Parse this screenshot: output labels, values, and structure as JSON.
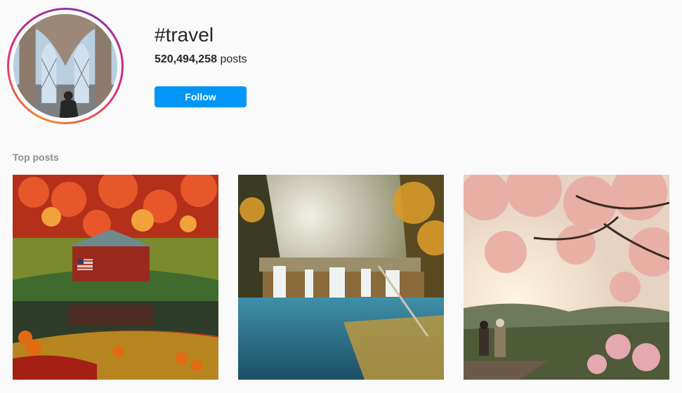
{
  "hashtag": {
    "title": "#travel",
    "post_count": "520,494,258",
    "post_suffix": "posts"
  },
  "actions": {
    "follow_label": "Follow"
  },
  "sections": {
    "top_posts_label": "Top posts"
  },
  "colors": {
    "follow_button": "#0095f6",
    "ring_start": "#f58529",
    "ring_end": "#dd2a7b"
  },
  "top_posts": [
    {
      "icon": "autumn-farm-image"
    },
    {
      "icon": "waterfall-image"
    },
    {
      "icon": "cherry-blossom-image"
    }
  ]
}
